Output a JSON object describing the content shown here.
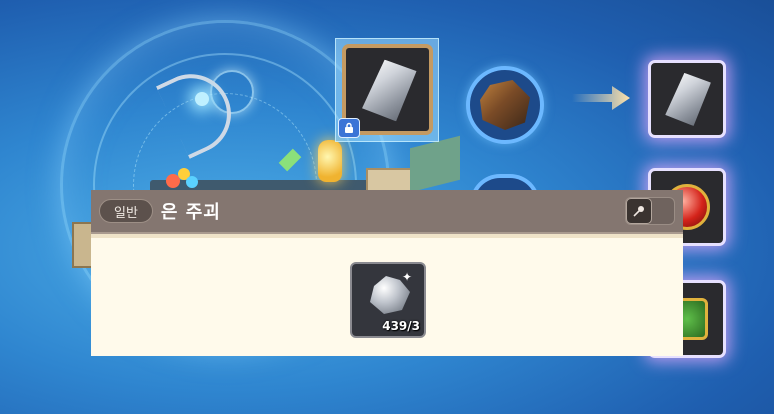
{
  "tooltip": {
    "grade": "일반",
    "item_name": "은 주괴",
    "pin_icon": "pin-icon",
    "material": {
      "icon": "silver-ore-icon",
      "count": "439/3"
    }
  },
  "crafting": {
    "selected_slot_icon": "silver-ingot-icon",
    "lock_icon": "lock-icon",
    "ore_icon": "iron-ore-icon",
    "arrow_icon": "arrow-right-icon",
    "results": [
      {
        "icon": "silver-ingot-icon"
      },
      {
        "icon": "ruby-icon"
      },
      {
        "icon": "emerald-dice-icon"
      }
    ]
  },
  "colors": {
    "background": "#2f86d0",
    "tooltip_header": "#847670",
    "tooltip_body": "#fffaeb",
    "selected_frame": "#c49a62"
  }
}
